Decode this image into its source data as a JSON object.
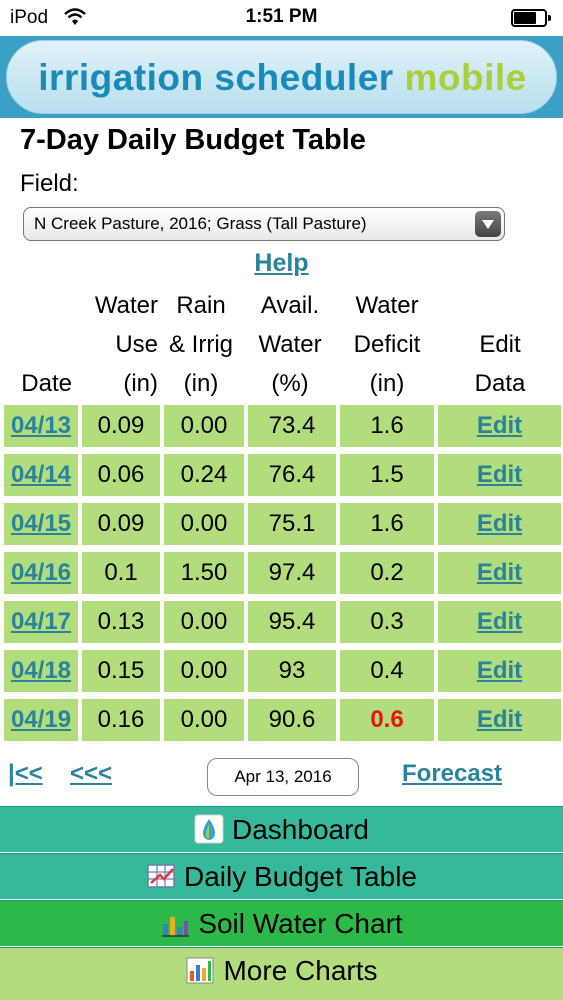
{
  "status_bar": {
    "carrier": "iPod",
    "time": "1:51 PM"
  },
  "banner": {
    "title_part1": "irrigation scheduler",
    "title_part2": "mobile"
  },
  "page": {
    "title": "7-Day Daily Budget Table",
    "field_label": "Field:",
    "field_value": "N Creek Pasture, 2016; Grass (Tall Pasture)",
    "help": "Help"
  },
  "table": {
    "headers": [
      {
        "lines": [
          "",
          "",
          "Date"
        ]
      },
      {
        "lines": [
          "Water",
          "Use",
          "(in)"
        ]
      },
      {
        "lines": [
          "Rain",
          "& Irrig",
          "(in)"
        ]
      },
      {
        "lines": [
          "Avail.",
          "Water",
          "(%)"
        ]
      },
      {
        "lines": [
          "Water",
          "Deficit",
          "(in)"
        ]
      },
      {
        "lines": [
          "",
          "Edit",
          "Data"
        ]
      }
    ],
    "rows": [
      {
        "date": "04/13",
        "water_use": "0.09",
        "rain_irrig": "0.00",
        "avail_water": "73.4",
        "deficit": "1.6",
        "edit": "Edit"
      },
      {
        "date": "04/14",
        "water_use": "0.06",
        "rain_irrig": "0.24",
        "avail_water": "76.4",
        "deficit": "1.5",
        "edit": "Edit"
      },
      {
        "date": "04/15",
        "water_use": "0.09",
        "rain_irrig": "0.00",
        "avail_water": "75.1",
        "deficit": "1.6",
        "edit": "Edit"
      },
      {
        "date": "04/16",
        "water_use": "0.1",
        "rain_irrig": "1.50",
        "avail_water": "97.4",
        "deficit": "0.2",
        "edit": "Edit"
      },
      {
        "date": "04/17",
        "water_use": "0.13",
        "rain_irrig": "0.00",
        "avail_water": "95.4",
        "deficit": "0.3",
        "edit": "Edit"
      },
      {
        "date": "04/18",
        "water_use": "0.15",
        "rain_irrig": "0.00",
        "avail_water": "93",
        "deficit": "0.4",
        "edit": "Edit"
      },
      {
        "date": "04/19",
        "water_use": "0.16",
        "rain_irrig": "0.00",
        "avail_water": "90.6",
        "deficit": "0.6",
        "edit": "Edit",
        "deficit_alert": true
      }
    ]
  },
  "nav": {
    "first": "|<<",
    "prev": "<<<",
    "date": "Apr 13, 2016",
    "forecast": "Forecast"
  },
  "menu": [
    {
      "label": "Dashboard",
      "icon": "dashboard-icon",
      "color": "#36b99a"
    },
    {
      "label": "Daily Budget Table",
      "icon": "budget-table-icon",
      "color": "#36b99a"
    },
    {
      "label": "Soil Water Chart",
      "icon": "soil-water-chart-icon",
      "color": "#2db94a"
    },
    {
      "label": "More Charts",
      "icon": "more-charts-icon",
      "color": "#b2dd7d"
    }
  ],
  "colors": {
    "banner": "#3aa0c6",
    "cell": "#b2dd7d",
    "link": "#29839c",
    "alert": "#ee1111"
  }
}
